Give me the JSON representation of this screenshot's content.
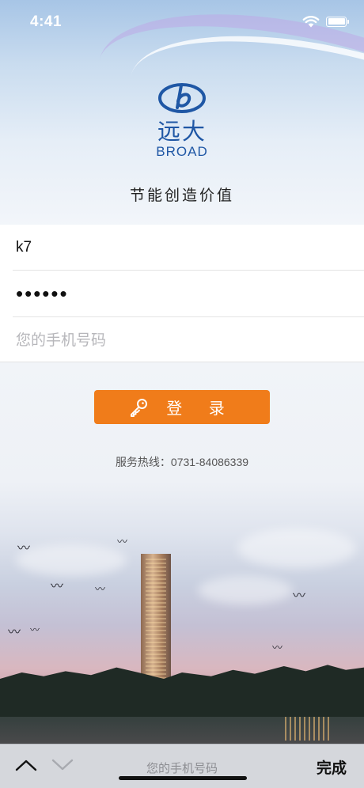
{
  "status_bar": {
    "time": "4:41"
  },
  "logo": {
    "name_cn": "远大",
    "name_en": "BROAD"
  },
  "slogan": "节能创造价值",
  "form": {
    "username_value": "k7",
    "password_value": "123456",
    "phone_placeholder": "您的手机号码"
  },
  "login_button": {
    "label": "登 录",
    "icon": "key-icon"
  },
  "hotline": "服务热线：0731-84086339",
  "keyboard_bar": {
    "hint": "您的手机号码",
    "done_label": "完成",
    "prev_icon": "chevron-up-icon",
    "next_icon": "chevron-down-icon"
  },
  "colors": {
    "brand_blue": "#1f57a5",
    "button_orange": "#f07c1a"
  }
}
